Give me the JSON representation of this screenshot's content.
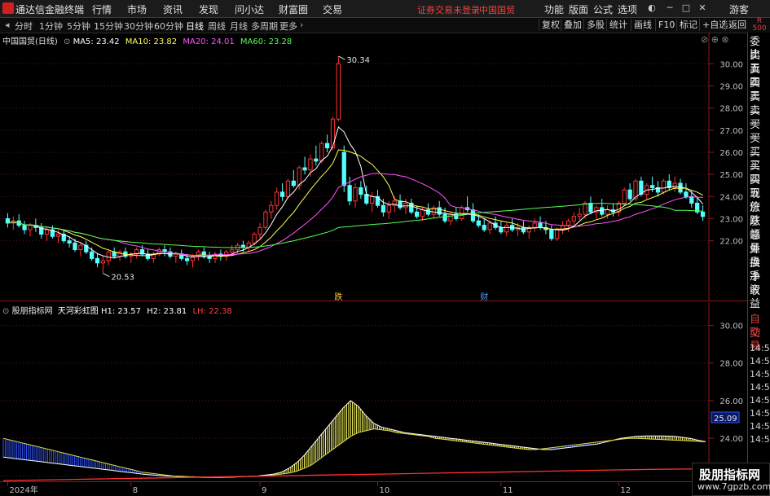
{
  "topbar": {
    "app_name": "通达信金融终端",
    "menus": [
      "行情",
      "市场",
      "资讯",
      "发现",
      "问小达",
      "财富圈",
      "交易"
    ],
    "warning": "证券交易未登录",
    "stock_name": "中国国贸",
    "right_menus": [
      "功能",
      "版面",
      "公式",
      "选项"
    ],
    "user": "游客",
    "colors": {
      "warning": "#ff3c3c",
      "logo": "#d21e1e"
    }
  },
  "toolbar": {
    "periods": [
      "分时",
      "1分钟",
      "5分钟",
      "15分钟",
      "30分钟",
      "60分钟",
      "日线",
      "周线",
      "月线",
      "多周期",
      "更多"
    ],
    "active_period": "日线",
    "buttons": [
      "复权",
      "叠加",
      "多股",
      "统计",
      "画线",
      "F10",
      "标记",
      "+自选",
      "返回"
    ]
  },
  "main_chart": {
    "title": "中国国贸(日线)",
    "legend": [
      {
        "label": "MA5: 23.42",
        "color": "#ffffff"
      },
      {
        "label": "MA10: 23.82",
        "color": "#ffff55"
      },
      {
        "label": "MA20: 24.01",
        "color": "#ff55ff"
      },
      {
        "label": "MA60: 23.28",
        "color": "#55ff55"
      }
    ],
    "high_label": "30.34",
    "low_label": "20.53",
    "markers": [
      "跌",
      "财"
    ],
    "y_ticks": [
      "30.00",
      "29.00",
      "28.00",
      "27.00",
      "26.00",
      "25.00",
      "24.00",
      "23.00",
      "22.00"
    ]
  },
  "indicator": {
    "name": "股朋指标网",
    "formula": "天河彩虹图",
    "legend": [
      {
        "label": "H1: 23.57",
        "color": "#ffffff"
      },
      {
        "label": "H2: 23.81",
        "color": "#ffffff"
      },
      {
        "label": "LH: 22.38",
        "color": "#ff4040"
      }
    ],
    "y_ticks": [
      "30.00",
      "28.00",
      "26.00",
      "24.00",
      "22.00"
    ],
    "current_value": "25.09"
  },
  "x_axis": {
    "labels": [
      "2024年",
      "8",
      "9",
      "10",
      "11",
      "12",
      "1"
    ]
  },
  "side_panel": {
    "top_label": "R",
    "top_sub": "500",
    "items": [
      "委比",
      "卖五",
      "卖四",
      "卖三",
      "卖二",
      "卖一",
      "买一",
      "买二",
      "买三",
      "买四",
      "买五",
      "现价",
      "涨跌",
      "涨幅",
      "总量",
      "外盘",
      "换手",
      "净资",
      "收益"
    ],
    "red_items": [
      "自动",
      "交易"
    ],
    "times": [
      "14:56",
      "14:56",
      "14:56",
      "14:56",
      "14:56",
      "14:56",
      "14:56",
      "14:56"
    ]
  },
  "watermark": {
    "title": "股朋指标网",
    "url": "www.7gpzb.com"
  },
  "chart_data": {
    "type": "candlestick",
    "title": "中国国贸(日线)",
    "ylim": [
      20.0,
      30.6
    ],
    "x_tick_labels": [
      "2024年",
      "8",
      "9",
      "10",
      "11",
      "12",
      "1"
    ],
    "candles": [
      [
        23.0,
        23.25,
        22.6,
        22.8
      ],
      [
        22.8,
        23.1,
        22.5,
        22.9
      ],
      [
        22.9,
        23.2,
        22.6,
        22.7
      ],
      [
        22.7,
        22.9,
        22.3,
        22.5
      ],
      [
        22.5,
        22.8,
        22.2,
        22.7
      ],
      [
        22.7,
        23.0,
        22.4,
        22.6
      ],
      [
        22.6,
        22.8,
        22.1,
        22.3
      ],
      [
        22.3,
        22.6,
        22.0,
        22.5
      ],
      [
        22.5,
        22.7,
        22.1,
        22.2
      ],
      [
        22.2,
        22.5,
        21.9,
        22.3
      ],
      [
        22.3,
        22.5,
        21.9,
        22.0
      ],
      [
        22.0,
        22.2,
        21.7,
        21.9
      ],
      [
        21.9,
        22.1,
        21.5,
        21.6
      ],
      [
        21.6,
        21.9,
        21.3,
        21.8
      ],
      [
        21.8,
        22.0,
        21.4,
        21.5
      ],
      [
        21.5,
        21.7,
        21.1,
        21.2
      ],
      [
        21.2,
        21.4,
        20.8,
        21.0
      ],
      [
        21.0,
        21.3,
        20.53,
        21.1
      ],
      [
        21.1,
        21.6,
        20.9,
        21.5
      ],
      [
        21.5,
        21.7,
        21.2,
        21.3
      ],
      [
        21.3,
        21.6,
        21.1,
        21.5
      ],
      [
        21.5,
        21.7,
        21.2,
        21.3
      ],
      [
        21.3,
        21.5,
        21.0,
        21.4
      ],
      [
        21.4,
        21.7,
        21.2,
        21.6
      ],
      [
        21.6,
        21.8,
        21.3,
        21.4
      ],
      [
        21.4,
        21.6,
        21.1,
        21.2
      ],
      [
        21.2,
        21.5,
        21.0,
        21.4
      ],
      [
        21.4,
        21.7,
        21.3,
        21.6
      ],
      [
        21.6,
        21.8,
        21.3,
        21.5
      ],
      [
        21.5,
        21.7,
        21.2,
        21.3
      ],
      [
        21.3,
        21.5,
        21.0,
        21.4
      ],
      [
        21.4,
        21.6,
        21.1,
        21.2
      ],
      [
        21.2,
        21.4,
        20.9,
        21.1
      ],
      [
        21.1,
        21.4,
        20.8,
        21.3
      ],
      [
        21.3,
        21.6,
        21.1,
        21.5
      ],
      [
        21.5,
        21.7,
        21.2,
        21.3
      ],
      [
        21.3,
        21.5,
        21.0,
        21.2
      ],
      [
        21.2,
        21.5,
        21.0,
        21.4
      ],
      [
        21.4,
        21.6,
        21.1,
        21.3
      ],
      [
        21.3,
        21.6,
        21.1,
        21.5
      ],
      [
        21.5,
        21.8,
        21.3,
        21.6
      ],
      [
        21.6,
        21.9,
        21.4,
        21.8
      ],
      [
        21.8,
        22.0,
        21.5,
        21.7
      ],
      [
        21.7,
        22.0,
        21.5,
        21.9
      ],
      [
        21.9,
        22.4,
        21.8,
        22.3
      ],
      [
        22.3,
        22.8,
        22.1,
        22.6
      ],
      [
        22.6,
        23.4,
        22.5,
        23.3
      ],
      [
        23.3,
        23.8,
        23.0,
        23.6
      ],
      [
        23.6,
        24.4,
        23.4,
        24.2
      ],
      [
        24.2,
        24.6,
        23.8,
        24.0
      ],
      [
        24.0,
        24.8,
        23.9,
        24.7
      ],
      [
        24.7,
        25.2,
        24.4,
        24.5
      ],
      [
        24.5,
        25.4,
        24.3,
        25.3
      ],
      [
        25.3,
        25.8,
        25.0,
        25.2
      ],
      [
        25.2,
        25.9,
        24.9,
        25.7
      ],
      [
        25.7,
        26.3,
        25.4,
        25.6
      ],
      [
        25.6,
        26.5,
        25.5,
        26.4
      ],
      [
        26.4,
        26.8,
        26.0,
        26.2
      ],
      [
        26.2,
        27.6,
        26.1,
        27.5
      ],
      [
        27.5,
        30.34,
        27.4,
        30.0
      ],
      [
        26.0,
        26.3,
        24.2,
        24.5
      ],
      [
        24.5,
        24.9,
        23.6,
        23.8
      ],
      [
        23.8,
        24.6,
        23.5,
        24.4
      ],
      [
        24.4,
        24.7,
        23.9,
        24.1
      ],
      [
        24.1,
        24.5,
        23.6,
        23.7
      ],
      [
        23.7,
        24.2,
        23.3,
        24.0
      ],
      [
        24.0,
        24.3,
        23.5,
        23.6
      ],
      [
        23.6,
        23.9,
        23.1,
        23.3
      ],
      [
        23.3,
        23.8,
        23.0,
        23.6
      ],
      [
        23.6,
        24.0,
        23.3,
        23.8
      ],
      [
        23.8,
        24.1,
        23.4,
        23.5
      ],
      [
        23.5,
        23.9,
        23.2,
        23.7
      ],
      [
        23.7,
        23.9,
        23.2,
        23.3
      ],
      [
        23.3,
        23.6,
        23.0,
        23.1
      ],
      [
        23.1,
        23.5,
        22.9,
        23.4
      ],
      [
        23.4,
        23.7,
        23.1,
        23.2
      ],
      [
        23.2,
        23.6,
        23.0,
        23.5
      ],
      [
        23.5,
        23.8,
        23.1,
        23.2
      ],
      [
        23.2,
        23.5,
        22.8,
        22.9
      ],
      [
        22.9,
        23.3,
        22.7,
        23.2
      ],
      [
        23.2,
        23.5,
        22.9,
        23.0
      ],
      [
        23.0,
        23.6,
        22.9,
        23.5
      ],
      [
        23.5,
        24.0,
        23.3,
        23.4
      ],
      [
        23.4,
        23.7,
        22.8,
        22.9
      ],
      [
        22.9,
        23.2,
        22.6,
        22.7
      ],
      [
        22.7,
        23.0,
        22.4,
        22.5
      ],
      [
        22.5,
        22.9,
        22.3,
        22.8
      ],
      [
        22.8,
        23.1,
        22.5,
        22.6
      ],
      [
        22.6,
        22.9,
        22.3,
        22.4
      ],
      [
        22.4,
        22.8,
        22.2,
        22.7
      ],
      [
        22.7,
        23.0,
        22.4,
        22.5
      ],
      [
        22.5,
        22.8,
        22.2,
        22.6
      ],
      [
        22.6,
        22.9,
        22.3,
        22.4
      ],
      [
        22.4,
        22.7,
        22.1,
        22.6
      ],
      [
        22.6,
        23.0,
        22.4,
        22.8
      ],
      [
        22.8,
        23.1,
        22.5,
        22.6
      ],
      [
        22.6,
        22.9,
        22.3,
        22.5
      ],
      [
        22.5,
        22.7,
        22.0,
        22.1
      ],
      [
        22.1,
        22.6,
        22.0,
        22.5
      ],
      [
        22.5,
        22.9,
        22.3,
        22.7
      ],
      [
        22.7,
        23.0,
        22.4,
        22.9
      ],
      [
        22.9,
        23.3,
        22.7,
        23.1
      ],
      [
        23.1,
        23.5,
        22.9,
        23.2
      ],
      [
        23.2,
        23.8,
        23.0,
        23.7
      ],
      [
        23.7,
        24.0,
        23.2,
        23.3
      ],
      [
        23.3,
        23.6,
        23.0,
        23.5
      ],
      [
        23.5,
        23.9,
        23.1,
        23.2
      ],
      [
        23.2,
        23.6,
        23.0,
        23.4
      ],
      [
        23.4,
        23.7,
        23.1,
        23.3
      ],
      [
        23.3,
        23.8,
        23.1,
        23.7
      ],
      [
        23.7,
        24.4,
        23.6,
        24.3
      ],
      [
        24.3,
        24.6,
        23.8,
        23.9
      ],
      [
        23.9,
        24.8,
        23.8,
        24.7
      ],
      [
        24.7,
        24.9,
        24.0,
        24.1
      ],
      [
        24.1,
        24.6,
        23.9,
        24.5
      ],
      [
        24.5,
        24.9,
        24.2,
        24.4
      ],
      [
        24.4,
        24.7,
        24.0,
        24.2
      ],
      [
        24.2,
        24.8,
        24.1,
        24.7
      ],
      [
        24.7,
        25.0,
        24.3,
        24.4
      ],
      [
        24.4,
        24.9,
        24.2,
        24.6
      ],
      [
        24.6,
        24.8,
        24.1,
        24.2
      ],
      [
        24.2,
        24.6,
        23.9,
        24.0
      ],
      [
        24.0,
        24.3,
        23.5,
        23.7
      ],
      [
        23.7,
        24.0,
        23.2,
        23.3
      ],
      [
        23.3,
        23.6,
        22.9,
        23.1
      ]
    ],
    "series": [
      {
        "name": "MA5",
        "color": "#ffffff"
      },
      {
        "name": "MA10",
        "color": "#ffff55"
      },
      {
        "name": "MA20",
        "color": "#ff55ff"
      },
      {
        "name": "MA60",
        "color": "#55ff55"
      }
    ],
    "indicator": {
      "ylim": [
        21.8,
        30.8
      ],
      "h_values": [
        23.0,
        22.95,
        22.9,
        22.85,
        22.8,
        22.75,
        22.7,
        22.65,
        22.6,
        22.55,
        22.5,
        22.45,
        22.4,
        22.35,
        22.3,
        22.25,
        22.2,
        22.15,
        22.1,
        22.06,
        22.03,
        22.0,
        21.98,
        21.96,
        21.94,
        21.93,
        21.92,
        21.92,
        21.92,
        21.93,
        21.94,
        21.96,
        21.98,
        22.0,
        22.05,
        22.1,
        22.2,
        22.4,
        22.7,
        23.1,
        23.6,
        24.1,
        24.6,
        25.1,
        25.6,
        26.0,
        25.7,
        25.2,
        24.8,
        24.6,
        24.5,
        24.4,
        24.3,
        24.25,
        24.2,
        24.15,
        24.1,
        24.05,
        24.0,
        23.95,
        23.9,
        23.85,
        23.8,
        23.75,
        23.7,
        23.65,
        23.6,
        23.55,
        23.5,
        23.45,
        23.4,
        23.4,
        23.45,
        23.5,
        23.55,
        23.6,
        23.65,
        23.7,
        23.8,
        23.9,
        24.0,
        24.05,
        24.1,
        24.12,
        24.13,
        24.13,
        24.12,
        24.1,
        24.05,
        24.0,
        23.9,
        23.82
      ],
      "h2_values": [
        24.0,
        23.9,
        23.8,
        23.7,
        23.6,
        23.5,
        23.4,
        23.3,
        23.2,
        23.1,
        23.0,
        22.9,
        22.8,
        22.7,
        22.6,
        22.5,
        22.4,
        22.3,
        22.2,
        22.15,
        22.1,
        22.05,
        22.0,
        21.98,
        21.96,
        21.95,
        21.94,
        21.93,
        21.93,
        21.94,
        21.95,
        21.96,
        21.97,
        21.98,
        22.0,
        22.05,
        22.1,
        22.15,
        22.25,
        22.4,
        22.6,
        22.9,
        23.2,
        23.5,
        23.8,
        24.1,
        24.3,
        24.4,
        24.5,
        24.45,
        24.4,
        24.3,
        24.25,
        24.2,
        24.15,
        24.1,
        24.0,
        23.95,
        23.9,
        23.85,
        23.8,
        23.75,
        23.7,
        23.65,
        23.6,
        23.55,
        23.5,
        23.45,
        23.4,
        23.4,
        23.45,
        23.5,
        23.55,
        23.6,
        23.65,
        23.7,
        23.75,
        23.8,
        23.85,
        23.9,
        23.95,
        24.0,
        24.0,
        23.98,
        23.96,
        23.94,
        23.92,
        23.9,
        23.88,
        23.86,
        23.84,
        23.81
      ],
      "lh_values": [
        21.75,
        21.8,
        21.85,
        21.9,
        21.95,
        22.0,
        22.05,
        22.1,
        22.15,
        22.2,
        22.25,
        22.3,
        22.35,
        22.38
      ]
    }
  }
}
